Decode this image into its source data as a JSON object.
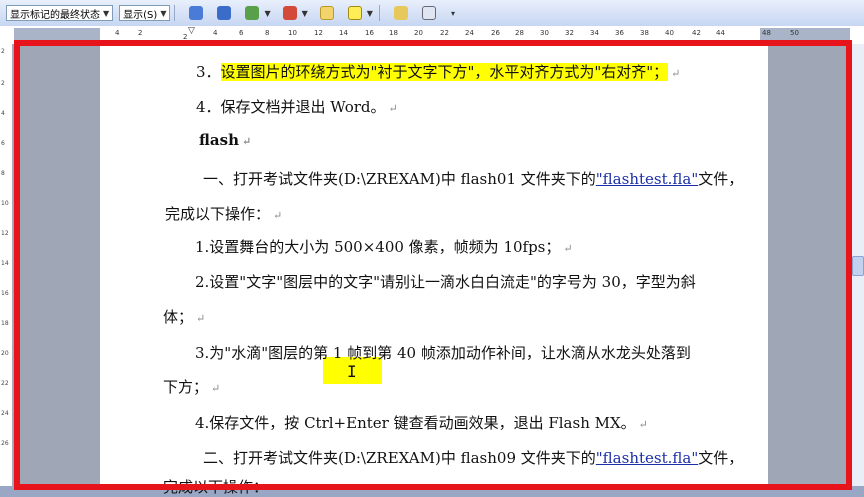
{
  "toolbar": {
    "markup_view": "显示标记的最终状态",
    "show_menu": "显示(S)"
  },
  "ruler_top": [
    "4",
    "2",
    "2",
    "4",
    "6",
    "8",
    "10",
    "12",
    "14",
    "16",
    "18",
    "20",
    "22",
    "24",
    "26",
    "28",
    "30",
    "32",
    "34",
    "36",
    "38",
    "40",
    "42",
    "44",
    "48",
    "50"
  ],
  "ruler_left": [
    "2",
    "2",
    "4",
    "6",
    "8",
    "10",
    "12",
    "14",
    "16",
    "18",
    "20",
    "22",
    "24",
    "26"
  ],
  "document": {
    "item3_num": "3．",
    "item3_text": "设置图片的环绕方式为\"衬于文字下方\"，水平对齐方式为\"右对齐\"；",
    "item4": "4．保存文档并退出 Word。",
    "heading": "flash",
    "p1_a": "一、打开考试文件夹(D:\\ZREXAM)中 flash01 文件夹下的",
    "p1_link": "\"flashtest.fla\"",
    "p1_b": "文件，",
    "p1_cont": "完成以下操作：",
    "step1": "1.设置舞台的大小为 500×400 像素，帧频为 10fps；",
    "step2": "2.设置\"文字\"图层中的文字\"请别让一滴水白白流走\"的字号为 30，字型为斜",
    "step2_cont": "体；",
    "step3": "3.为\"水滴\"图层的第 1 帧到第 40 帧添加动作补间，让水滴从水龙头处落到",
    "step3_cont": "下方；",
    "step4": "4.保存文件，按 Ctrl+Enter 键查看动画效果，退出 Flash MX。",
    "p2_a": "二、打开考试文件夹(D:\\ZREXAM)中 flash09 文件夹下的",
    "p2_link": "\"flashtest.fla\"",
    "p2_b": "文件，",
    "p2_cont": "完成以下操作：",
    "para_mark": "↵"
  },
  "colors": {
    "frame": "#e8141b",
    "highlight": "#ffff00",
    "link": "#1b2fa8"
  }
}
